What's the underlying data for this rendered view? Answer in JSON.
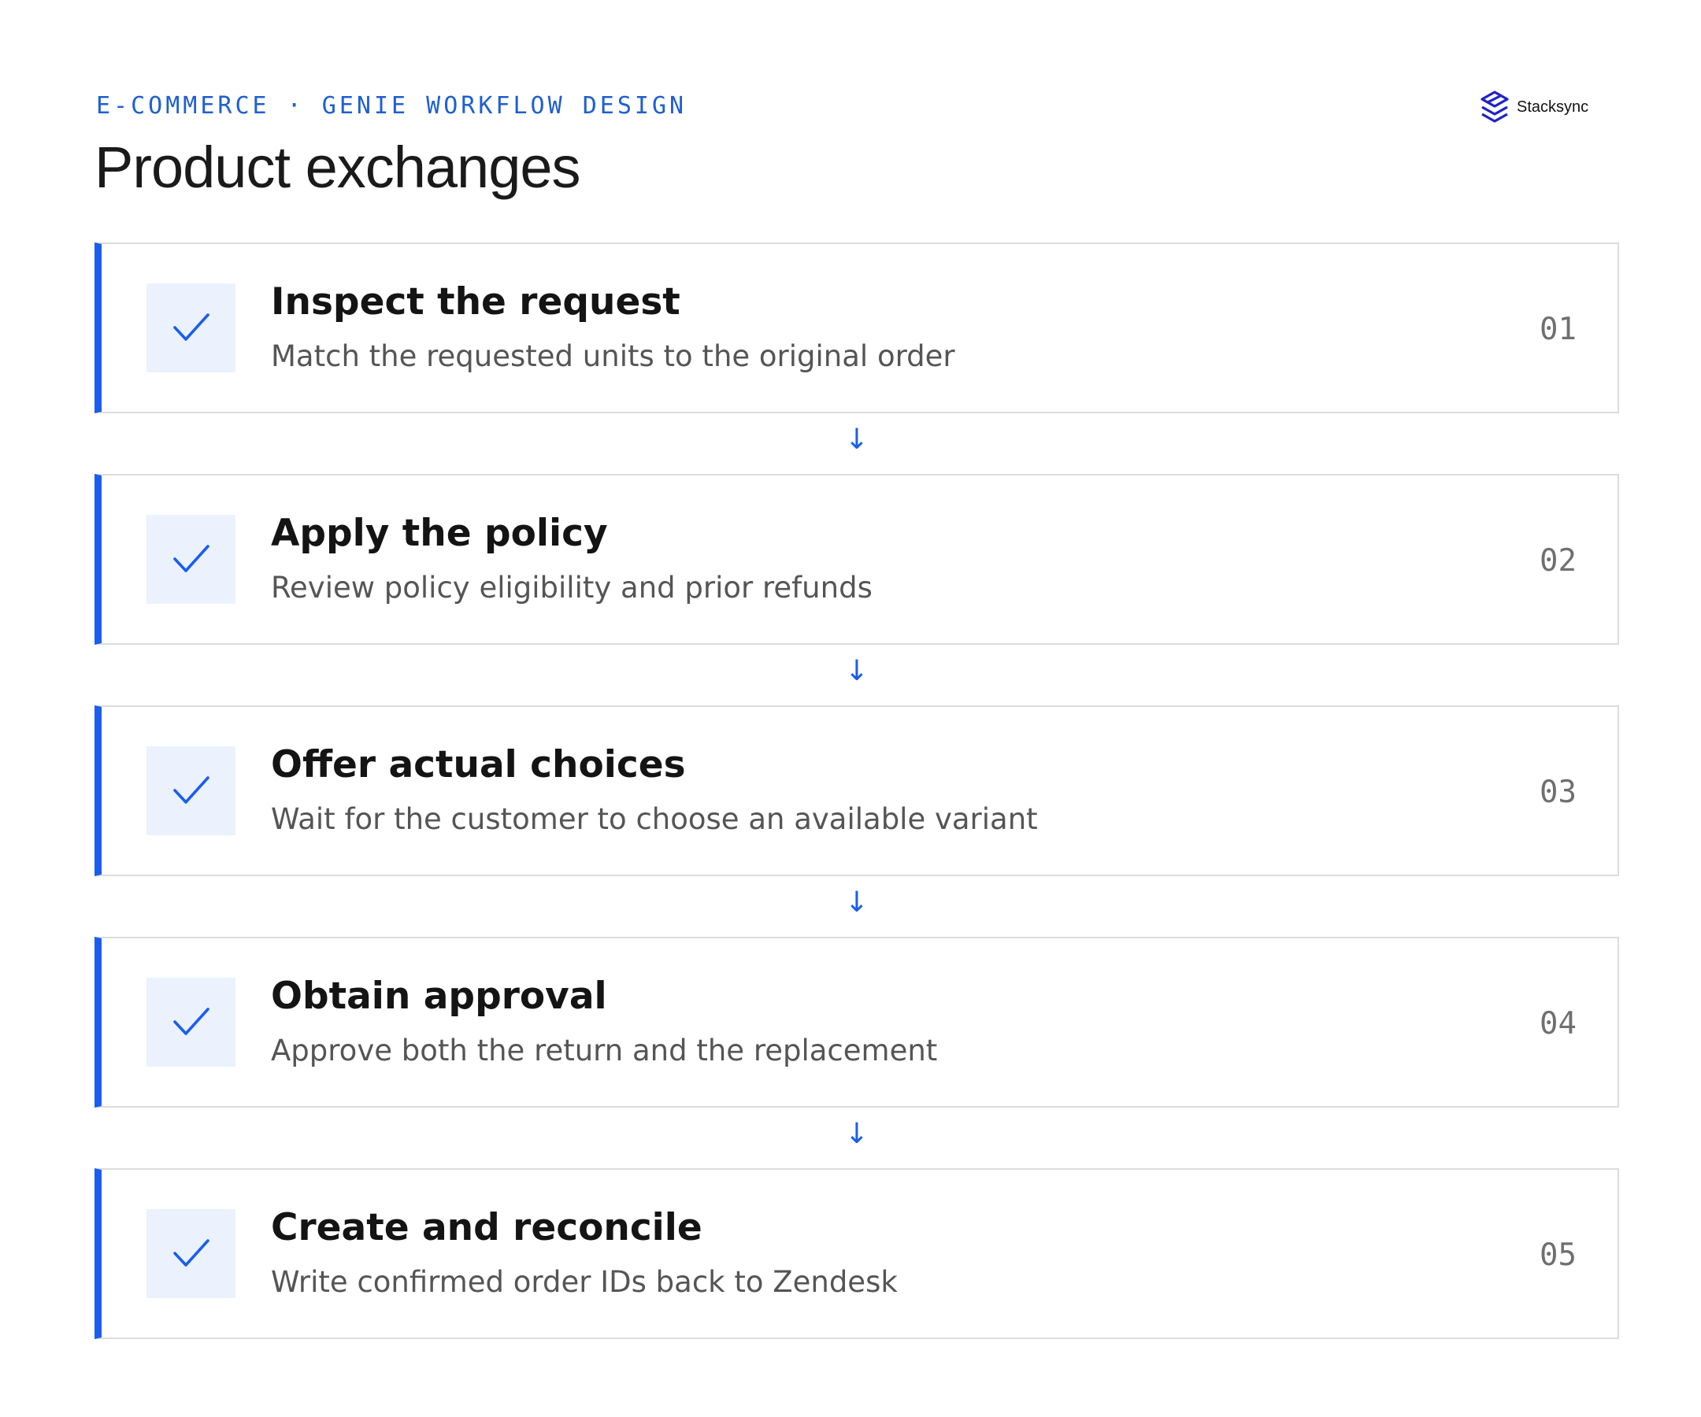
{
  "header": {
    "eyebrow": "E-COMMERCE · GENIE WORKFLOW DESIGN",
    "title": "Product exchanges"
  },
  "logo": {
    "text": "Stacksync",
    "icon": "stacksync-logo-icon",
    "color": "#1e22c8"
  },
  "colors": {
    "accent": "#1a5ef0",
    "check_background": "#ebf2fe",
    "border": "#dcdcdc"
  },
  "connector_glyph": "↓",
  "steps": [
    {
      "title": "Inspect the request",
      "description": "Match the requested units to the original order",
      "number": "01",
      "icon": "check-icon"
    },
    {
      "title": "Apply the policy",
      "description": "Review policy eligibility and prior refunds",
      "number": "02",
      "icon": "check-icon"
    },
    {
      "title": "Offer actual choices",
      "description": "Wait for the customer to choose an available variant",
      "number": "03",
      "icon": "check-icon"
    },
    {
      "title": "Obtain approval",
      "description": "Approve both the return and the replacement",
      "number": "04",
      "icon": "check-icon"
    },
    {
      "title": "Create and reconcile",
      "description": "Write confirmed order IDs back to Zendesk",
      "number": "05",
      "icon": "check-icon"
    }
  ]
}
